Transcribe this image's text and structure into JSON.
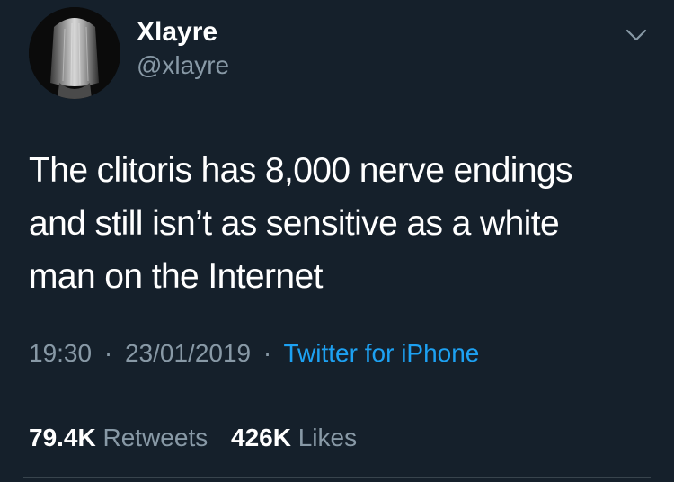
{
  "author": {
    "display_name": "Xlayre",
    "handle": "@xlayre",
    "avatar_icon": "profile-photo"
  },
  "menu_icon": "chevron-down-icon",
  "tweet": {
    "lines": [
      "The clitoris has 8,000 nerve endings",
      "and still isn’t as sensitive as a white",
      "man on the Internet"
    ]
  },
  "meta": {
    "time": "19:30",
    "separator": "·",
    "date": "23/01/2019",
    "source": "Twitter for iPhone"
  },
  "stats": {
    "retweets_count": "79.4K",
    "retweets_label": "Retweets",
    "likes_count": "426K",
    "likes_label": "Likes"
  },
  "colors": {
    "background": "#15202b",
    "primary_text": "#ffffff",
    "secondary_text": "#8899a6",
    "link": "#1da1f2",
    "divider": "#38444d"
  }
}
